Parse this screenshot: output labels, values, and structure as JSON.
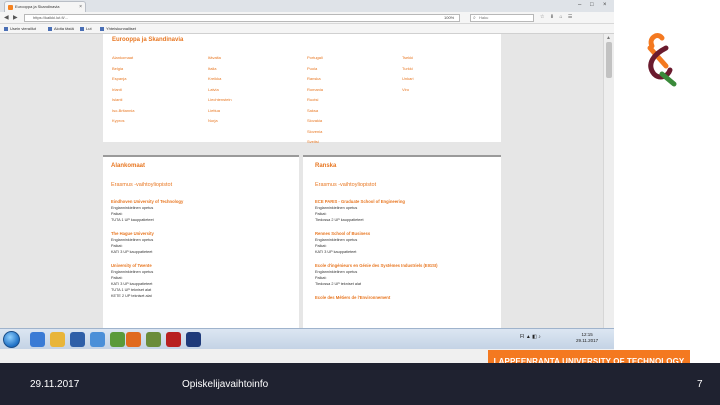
{
  "browser": {
    "tab_title": "Eurooppa ja Skandinavia",
    "url": "https://kaikki.lut.fi/...",
    "zoom": "100%",
    "search_placeholder": "Haku",
    "bookmarks": [
      "Usein vieraillut",
      "Aloita tästä",
      "Lut",
      "Yhteiskunnalliset"
    ]
  },
  "main": {
    "title": "Eurooppa ja Skandinavia",
    "countries": [
      [
        "Alankomaat",
        "Itävalta",
        "Portugali",
        "Tsekki"
      ],
      [
        "Belgia",
        "Italia",
        "Puola",
        "Turkki"
      ],
      [
        "Espanja",
        "Kreikka",
        "Ranska",
        "Unkari"
      ],
      [
        "Irlanti",
        "Latvia",
        "Romania",
        "Viro"
      ],
      [
        "Islanti",
        "Liechtenstein",
        "Ruotsi",
        ""
      ],
      [
        "Iso-Britannia",
        "Liettua",
        "Saksa",
        ""
      ],
      [
        "Kypros",
        "Norja",
        "Slovakia",
        ""
      ],
      [
        "",
        "",
        "Slovenia",
        ""
      ],
      [
        "",
        "",
        "Sveitsi",
        ""
      ]
    ]
  },
  "left_card": {
    "title": "Alankomaat",
    "subtitle": "Erasmus -vaihtoyliopistot",
    "items": [
      {
        "name": "Eindhoven University of Technology",
        "lines": [
          "Englanninkielinen opetus",
          "Paikat:",
          "TUTA 1 UP kauppatieteet"
        ]
      },
      {
        "name": "The Hague University",
        "lines": [
          "Englanninkielinen opetus",
          "Paikat:",
          "KATI 3 UP kauppatieteet"
        ]
      },
      {
        "name": "University of Twente",
        "lines": [
          "Englanninkielinen opetus",
          "Paikat:",
          "KATI 3 UP kauppatieteet",
          "TUTA 1 UP tekniset alat",
          "KETE 2 UP tekniset alat"
        ]
      }
    ]
  },
  "right_card": {
    "title": "Ranska",
    "subtitle": "Erasmus -vaihtoyliopistot",
    "items": [
      {
        "name": "ECE PARIS - Graduate School of Engineering",
        "lines": [
          "Englanninkielinen opetus",
          "Paikat:",
          "Tiedossa 2 UP kauppatieteet"
        ]
      },
      {
        "name": "Rennes School of Business",
        "lines": [
          "Englanninkielinen opetus",
          "Paikat:",
          "KATI 3 UP kauppatieteet"
        ]
      },
      {
        "name": "Ecole d'ingénieurs en Génie des Systèmes Industriels (EIGSI)",
        "lines": [
          "Englanninkielinen opetus",
          "Paikat:",
          "Tiedossa 2 UP tekniset alat"
        ]
      },
      {
        "name": "Ecole des Métiers de l'Environnement",
        "lines": []
      }
    ]
  },
  "taskbar": {
    "tray_lang": "FI",
    "clock_time": "12:15",
    "clock_date": "29.11.2017"
  },
  "banner": "LAPPEENRANTA UNIVERSITY OF TECHNOLOGY",
  "footer": {
    "date": "29.11.2017",
    "title": "Opiskelijavaihtoinfo",
    "page": "7"
  },
  "colors": {
    "accent": "#e87722",
    "banner": "#f47920",
    "footer": "#1f2230"
  }
}
